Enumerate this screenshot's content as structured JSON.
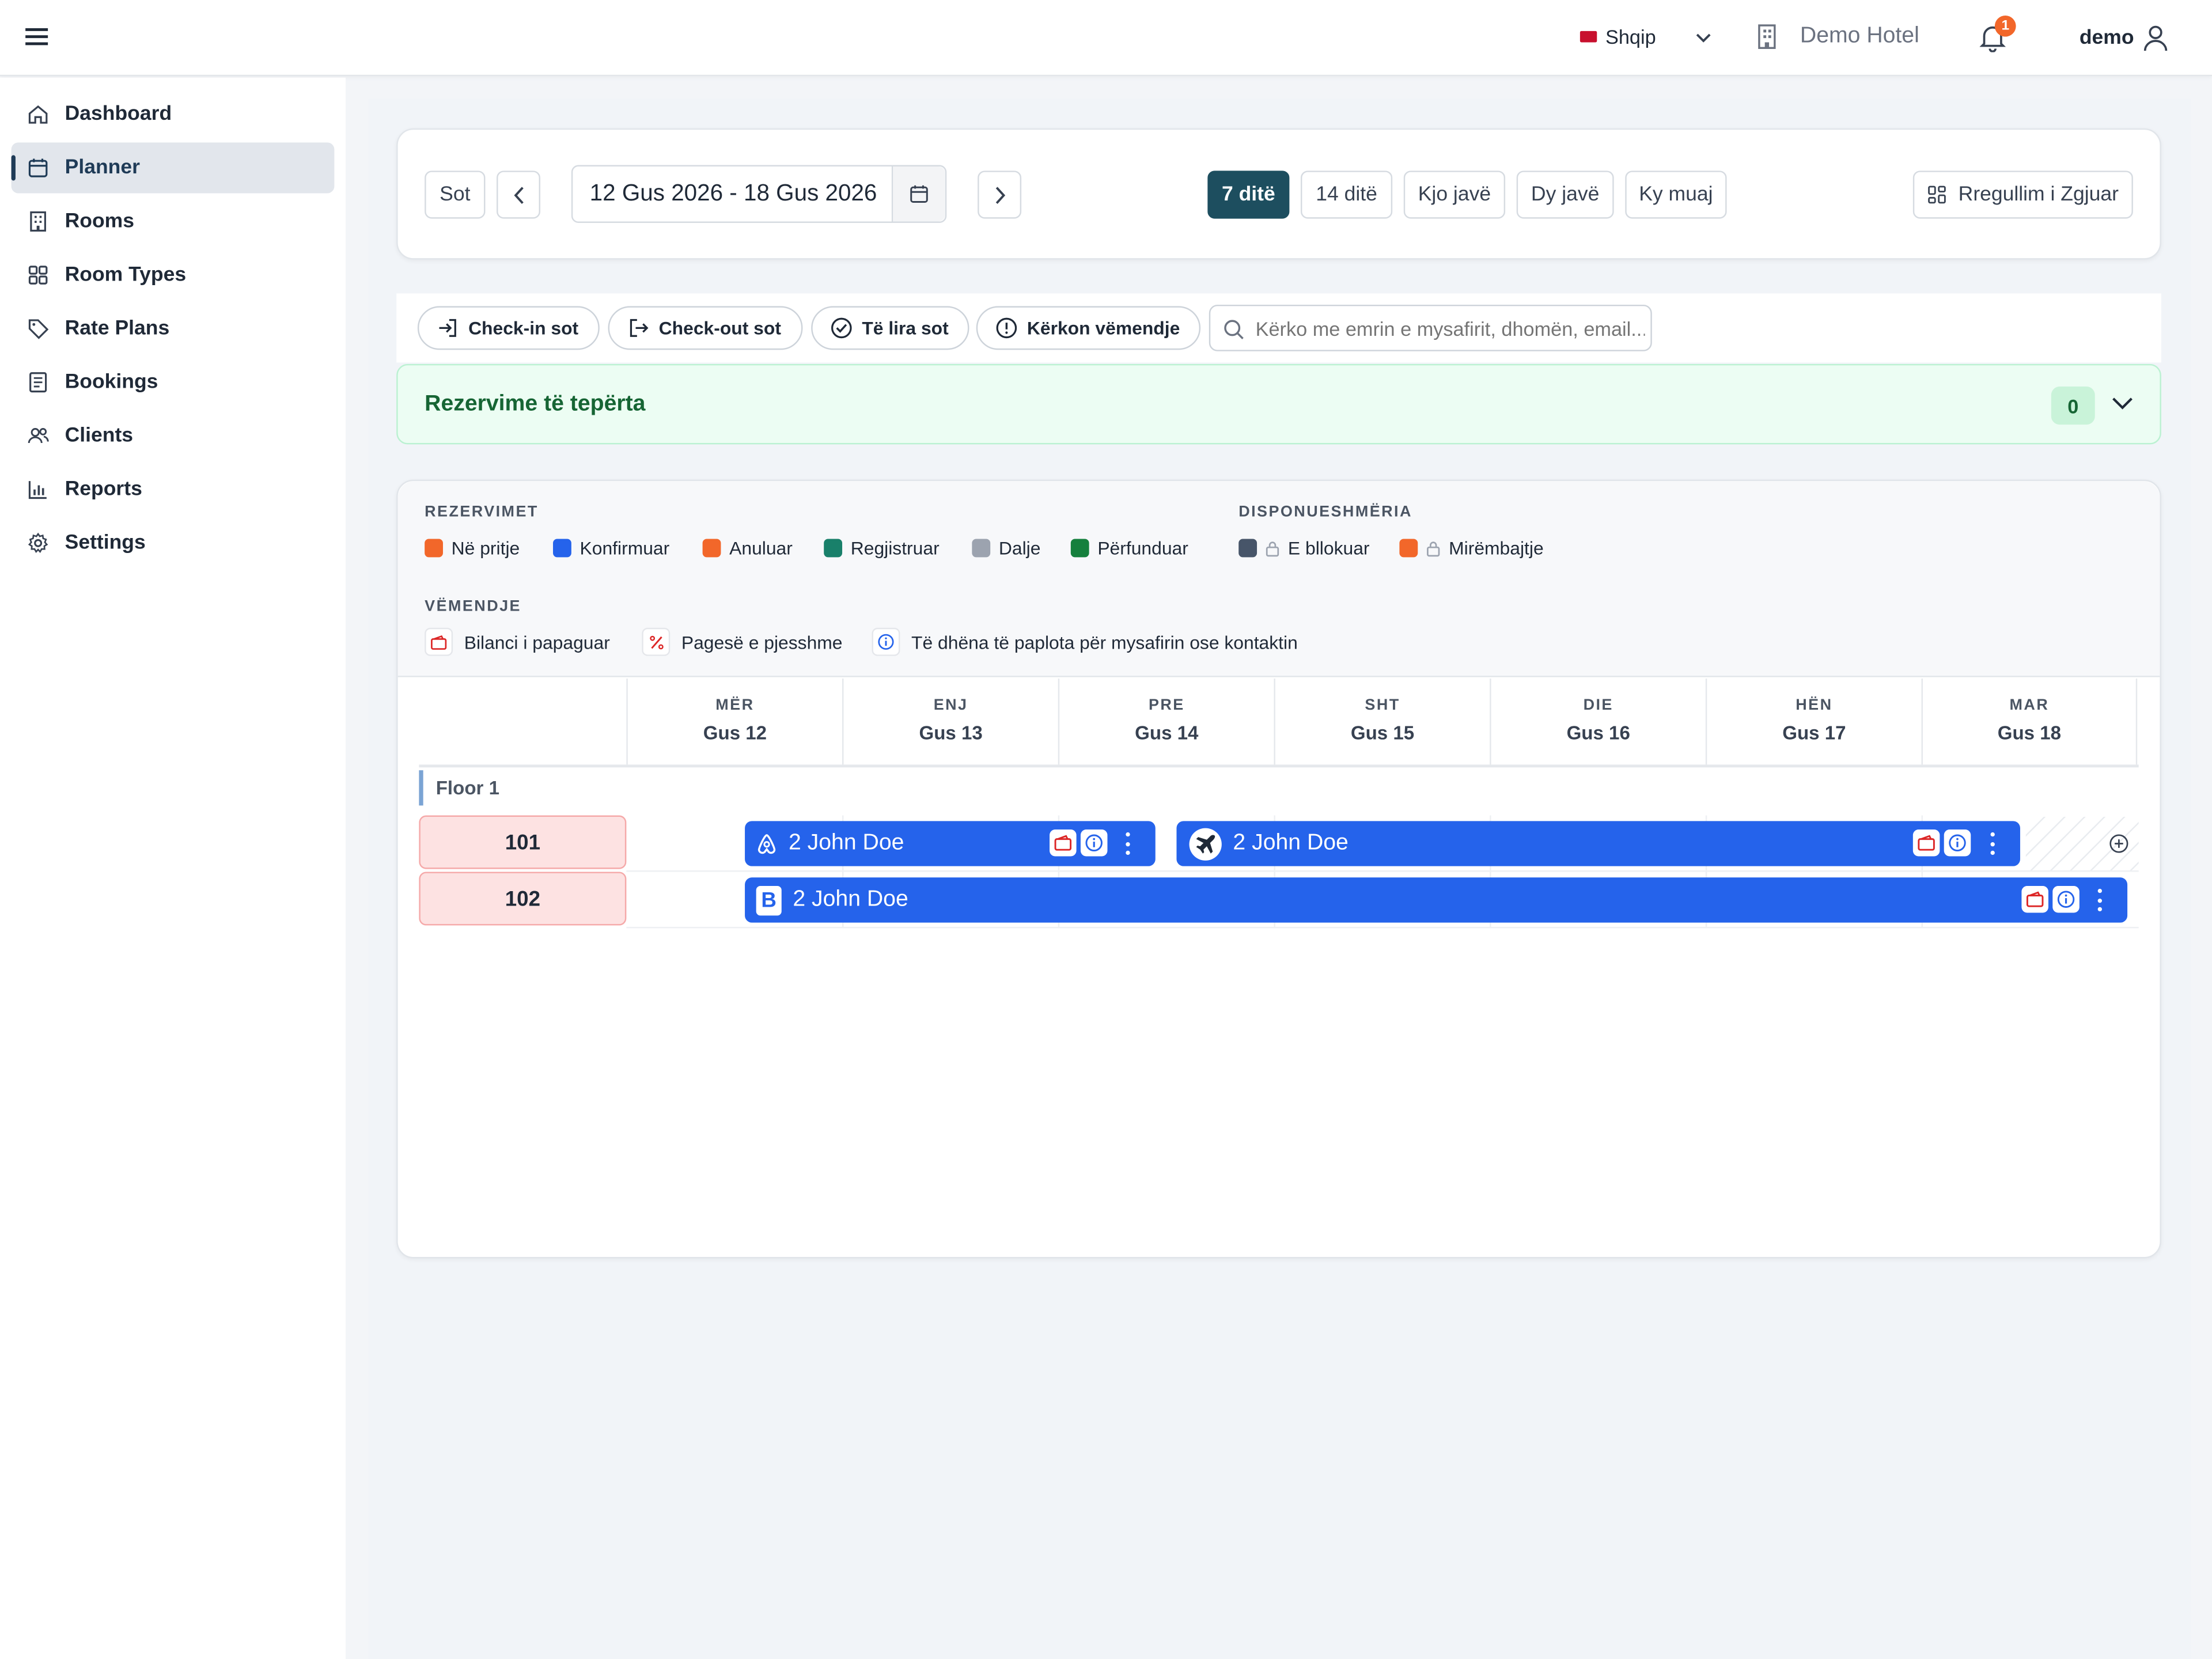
{
  "topbar": {
    "language": "Shqip",
    "hotel": "Demo Hotel",
    "notifications_count": "1",
    "user": "demo"
  },
  "sidebar": {
    "items": [
      {
        "label": "Dashboard",
        "icon": "home-icon"
      },
      {
        "label": "Planner",
        "icon": "calendar-icon",
        "active": true
      },
      {
        "label": "Rooms",
        "icon": "building-icon"
      },
      {
        "label": "Room Types",
        "icon": "grid-icon"
      },
      {
        "label": "Rate Plans",
        "icon": "tag-icon"
      },
      {
        "label": "Bookings",
        "icon": "list-icon"
      },
      {
        "label": "Clients",
        "icon": "users-icon"
      },
      {
        "label": "Reports",
        "icon": "bar-chart-icon"
      },
      {
        "label": "Settings",
        "icon": "gear-icon"
      }
    ]
  },
  "toolbar": {
    "today": "Sot",
    "date_range": "12 Gus 2026 - 18 Gus 2026",
    "views": [
      "7 ditë",
      "14 ditë",
      "Kjo javë",
      "Dy javë",
      "Ky muaj"
    ],
    "active_view": "7 ditë",
    "compact": "Rregullim i Zgjuar"
  },
  "filters": {
    "checkin": "Check-in sot",
    "checkout": "Check-out sot",
    "free": "Të lira sot",
    "attention": "Kërkon vëmendje",
    "search_placeholder": "Kërko me emrin e mysafirit, dhomën, email..."
  },
  "overbooking": {
    "title": "Rezervime të tepërta",
    "count": "0"
  },
  "legend": {
    "bookings_title": "REZERVIMET",
    "bookings": [
      {
        "label": "Në pritje",
        "color": "#f2672a"
      },
      {
        "label": "Konfirmuar",
        "color": "#2563eb"
      },
      {
        "label": "Anuluar",
        "color": "#f2672a"
      },
      {
        "label": "Regjistruar",
        "color": "#19806a"
      },
      {
        "label": "Dalje",
        "color": "#9ca3af"
      },
      {
        "label": "Përfunduar",
        "color": "#15803d"
      }
    ],
    "availability_title": "DISPONUESHMËRIA",
    "availability": [
      {
        "label": "E bllokuar",
        "color": "#475569"
      },
      {
        "label": "Mirëmbajtje",
        "color": "#f2672a"
      }
    ],
    "attention_title": "VËMENDJE",
    "attention": [
      {
        "label": "Bilanci i papaguar",
        "icon": "wallet-icon"
      },
      {
        "label": "Pagesë e pjesshme",
        "icon": "percent-icon"
      },
      {
        "label": "Të dhëna të paplota për mysafirin ose kontaktin",
        "icon": "info-icon"
      }
    ]
  },
  "days": [
    {
      "dow": "MËR",
      "date": "Gus 12"
    },
    {
      "dow": "ENJ",
      "date": "Gus 13"
    },
    {
      "dow": "PRE",
      "date": "Gus 14"
    },
    {
      "dow": "SHT",
      "date": "Gus 15"
    },
    {
      "dow": "DIE",
      "date": "Gus 16"
    },
    {
      "dow": "HËN",
      "date": "Gus 17"
    },
    {
      "dow": "MAR",
      "date": "Gus 18"
    }
  ],
  "floor": "Floor 1",
  "rooms": [
    "101",
    "102"
  ],
  "bookings": [
    {
      "room": "101",
      "guest": "2 John Doe",
      "source": "airbnb-icon",
      "status": "Konfirmuar"
    },
    {
      "room": "101",
      "guest": "2 John Doe",
      "source": "plane-icon",
      "status": "Konfirmuar"
    },
    {
      "room": "102",
      "guest": "2 John Doe",
      "source": "booking-b-icon",
      "status": "Konfirmuar"
    }
  ]
}
